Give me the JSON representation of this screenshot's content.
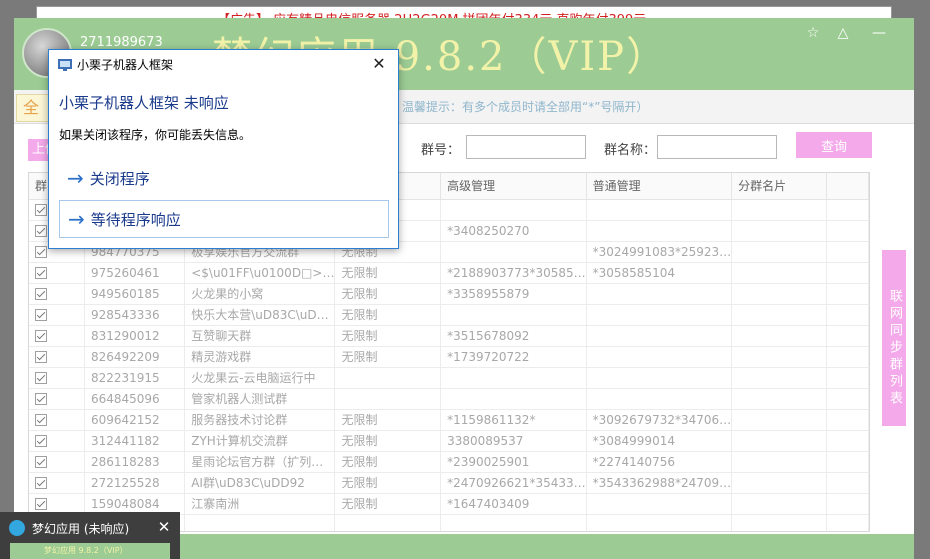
{
  "ad": {
    "text": "【广告】 应有精品电信服务器 2H2G20M 拼团年付334元 直购年付399元"
  },
  "header": {
    "qq_number": "2711989673",
    "app_title": "梦幻应用 9.8.2（VIP）",
    "star_icon": "☆",
    "triangle_icon": "△",
    "min_icon": "—"
  },
  "tabs": {
    "all_label": "全部"
  },
  "hint": "温馨提示：有多个成员时请全部用“*”号隔开）",
  "search": {
    "upload_label": "上传",
    "group_num_label": "群号：",
    "group_num_value": "",
    "group_name_label": "群名称：",
    "group_name_value": "",
    "query_label": "查询"
  },
  "table": {
    "columns": [
      "群",
      "",
      "",
      "",
      "高级管理",
      "普通管理",
      "分群名片"
    ],
    "rows": [
      {
        "id": "",
        "name": "",
        "limit": "",
        "senior": "",
        "normal": "",
        "card": ""
      },
      {
        "id": "",
        "name": "",
        "limit": "",
        "senior": "*3408250270",
        "normal": "",
        "card": ""
      },
      {
        "id": "984770375",
        "name": "极享娱乐官方交流群",
        "limit": "无限制",
        "senior": "",
        "normal": "*3024991083*25923…",
        "card": ""
      },
      {
        "id": "975260461",
        "name": "<$\\u01FF\\u0100D□>…",
        "limit": "无限制",
        "senior": "*2188903773*30585…",
        "normal": "*3058585104",
        "card": ""
      },
      {
        "id": "949560185",
        "name": "火龙果的小窝",
        "limit": "无限制",
        "senior": "*3358955879",
        "normal": "",
        "card": ""
      },
      {
        "id": "928543336",
        "name": "快乐大本营\\uD83C\\uD…",
        "limit": "无限制",
        "senior": "",
        "normal": "",
        "card": ""
      },
      {
        "id": "831290012",
        "name": "互赞聊天群",
        "limit": "无限制",
        "senior": "*3515678092",
        "normal": "",
        "card": ""
      },
      {
        "id": "826492209",
        "name": "精灵游戏群",
        "limit": "无限制",
        "senior": "*1739720722",
        "normal": "",
        "card": ""
      },
      {
        "id": "822231915",
        "name": "火龙果云-云电脑运行中",
        "limit": "",
        "senior": "",
        "normal": "",
        "card": ""
      },
      {
        "id": "664845096",
        "name": "管家机器人测试群",
        "limit": "",
        "senior": "",
        "normal": "",
        "card": ""
      },
      {
        "id": "609642152",
        "name": "服务器技术讨论群",
        "limit": "无限制",
        "senior": "*1159861132*",
        "normal": "*3092679732*34706…",
        "card": ""
      },
      {
        "id": "312441182",
        "name": "ZYH计算机交流群",
        "limit": "无限制",
        "senior": "3380089537",
        "normal": "*3084999014",
        "card": ""
      },
      {
        "id": "286118283",
        "name": "星雨论坛官方群（扩列…",
        "limit": "无限制",
        "senior": "*2390025901",
        "normal": "*2274140756",
        "card": ""
      },
      {
        "id": "272125528",
        "name": "AI群\\uD83C\\uDD92",
        "limit": "无限制",
        "senior": "*2470926621*35433…",
        "normal": "*3543362988*24709…",
        "card": ""
      },
      {
        "id": "159048084",
        "name": "江寨南洲",
        "limit": "无限制",
        "senior": "*1647403409",
        "normal": "",
        "card": ""
      },
      {
        "id": "",
        "name": "",
        "limit": "",
        "senior": "",
        "normal": "",
        "card": ""
      }
    ]
  },
  "sync_button": "联网同步群列表",
  "dialog": {
    "title": "小栗子机器人框架",
    "close_icon": "✕",
    "heading": "小栗子机器人框架 未响应",
    "message": "如果关闭该程序，你可能丢失信息。",
    "option_close": "关闭程序",
    "option_wait": "等待程序响应",
    "arrow_icon": "→"
  },
  "taskbar": {
    "title": "梦幻应用 (未响应)",
    "close_icon": "✕",
    "preview_text": "梦幻应用 9.8.2（VIP）"
  },
  "colors": {
    "header_green": "#9ccc94",
    "accent_pink": "#f4a9ea",
    "title_yellow": "#f2f2a8",
    "dialog_blue": "#1a3a8c"
  }
}
